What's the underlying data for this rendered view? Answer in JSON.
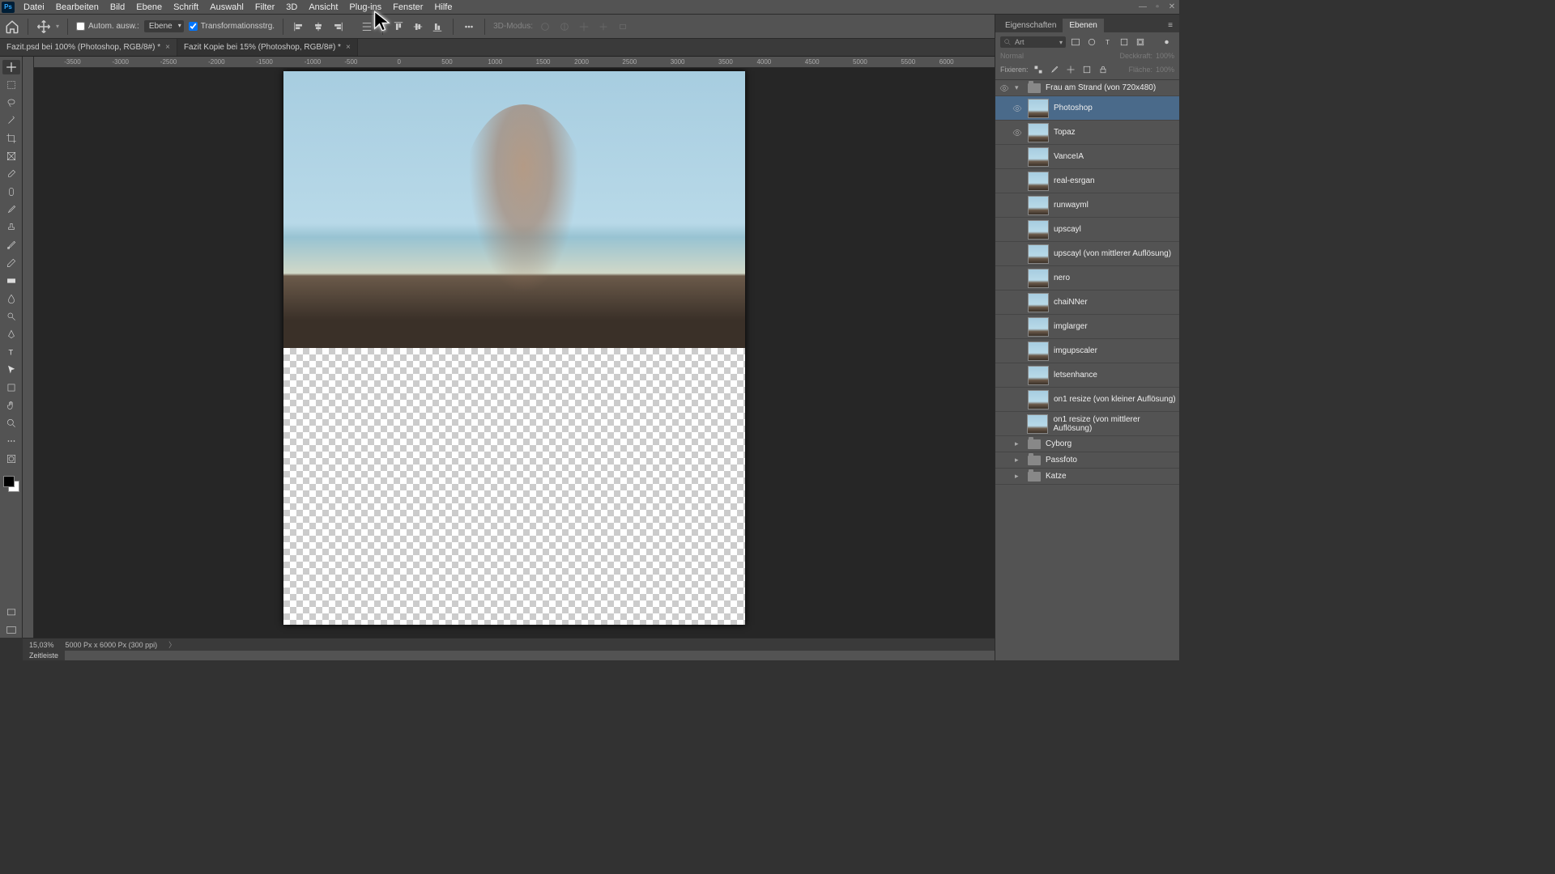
{
  "menu": {
    "items": [
      "Datei",
      "Bearbeiten",
      "Bild",
      "Ebene",
      "Schrift",
      "Auswahl",
      "Filter",
      "3D",
      "Ansicht",
      "Plug-ins",
      "Fenster",
      "Hilfe"
    ]
  },
  "optbar": {
    "auto_select": "Autom. ausw.:",
    "target": "Ebene",
    "transform_ctrl": "Transformationsstrg.",
    "threeD": "3D-Modus:"
  },
  "tabs": [
    {
      "title": "Fazit.psd bei 100% (Photoshop, RGB/8#) *",
      "active": false
    },
    {
      "title": "Fazit Kopie bei 15% (Photoshop, RGB/8#) *",
      "active": true
    }
  ],
  "ruler": {
    "ticks": [
      "-3500",
      "-3000",
      "-2500",
      "-2000",
      "-1500",
      "-1000",
      "-500",
      "0",
      "500",
      "1000",
      "1500",
      "2000",
      "2500",
      "3000",
      "3500",
      "4000",
      "4500",
      "5000",
      "5500",
      "6000"
    ]
  },
  "status": {
    "zoom": "15,03%",
    "docinfo": "5000 Px x 6000 Px (300 ppi)"
  },
  "timeline_label": "Zeitleiste",
  "rightpanel": {
    "tabs": {
      "properties": "Eigenschaften",
      "layers": "Ebenen"
    },
    "search_kind": "Art",
    "blend_mode": "Normal",
    "opacity_label": "Deckkraft:",
    "opacity_val": "100%",
    "lock_label": "Fixieren:",
    "fill_label": "Fläche:",
    "fill_val": "100%",
    "group_name": "Frau am Strand (von 720x480)",
    "layers": [
      {
        "name": "Photoshop",
        "visible": true,
        "selected": true
      },
      {
        "name": "Topaz",
        "visible": true
      },
      {
        "name": "VanceIA",
        "visible": false
      },
      {
        "name": "real-esrgan",
        "visible": false
      },
      {
        "name": "runwayml",
        "visible": false
      },
      {
        "name": "upscayl",
        "visible": false
      },
      {
        "name": "upscayl (von mittlerer Auflösung)",
        "visible": false
      },
      {
        "name": "nero",
        "visible": false
      },
      {
        "name": "chaiNNer",
        "visible": false
      },
      {
        "name": "imglarger",
        "visible": false
      },
      {
        "name": "imgupscaler",
        "visible": false
      },
      {
        "name": "letsenhance",
        "visible": false
      },
      {
        "name": "on1 resize (von kleiner Auflösung)",
        "visible": false
      },
      {
        "name": "on1 resize (von mittlerer Auflösung)",
        "visible": false
      }
    ],
    "groups": [
      "Cyborg",
      "Passfoto",
      "Katze"
    ]
  }
}
